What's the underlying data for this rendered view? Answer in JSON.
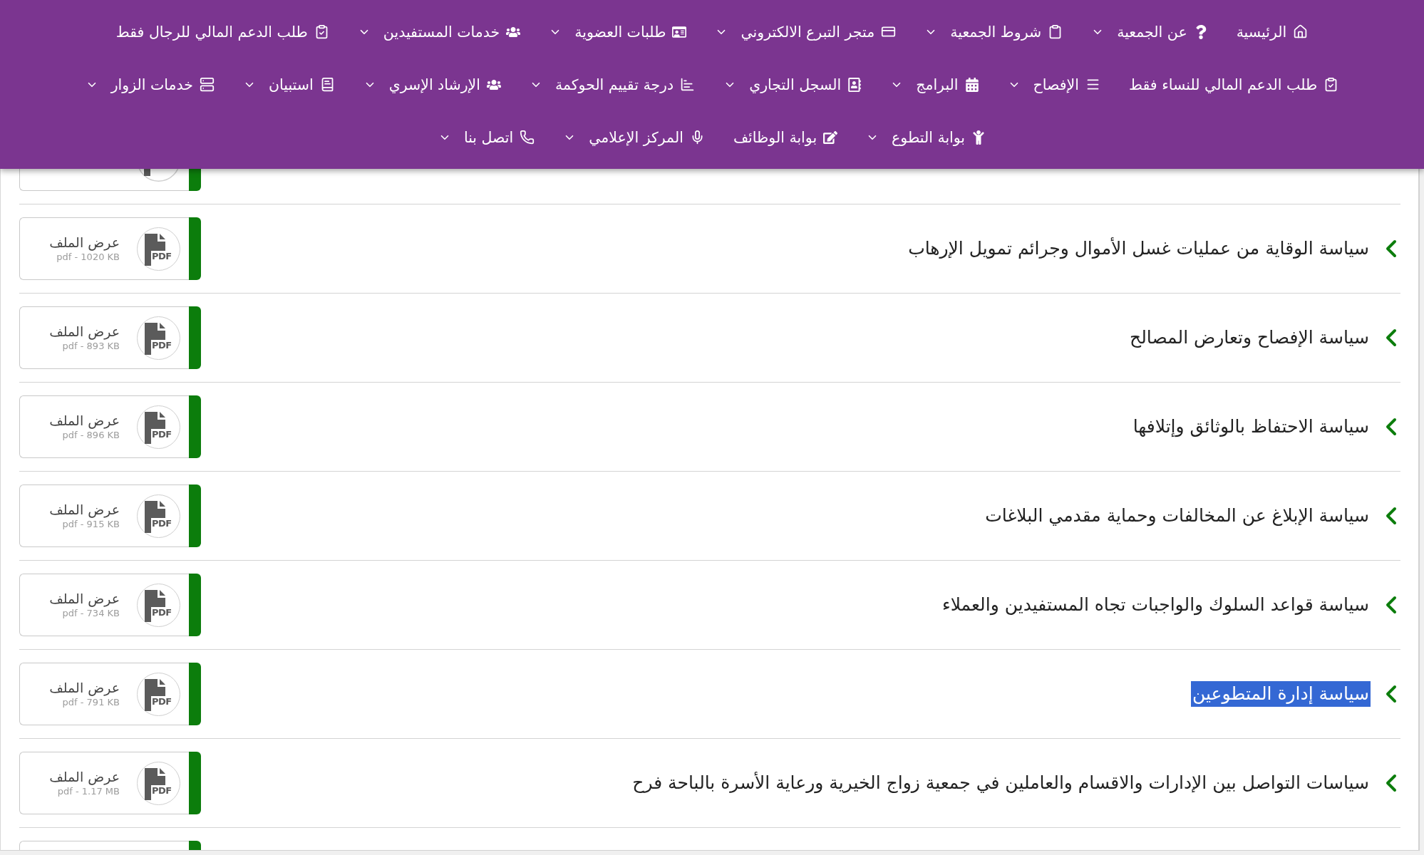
{
  "nav": {
    "rows": [
      {
        "items": [
          {
            "label": "الرئيسية",
            "dropdown": false
          },
          {
            "label": "عن الجمعية",
            "dropdown": true
          },
          {
            "label": "شروط الجمعية",
            "dropdown": true
          },
          {
            "label": "متجر التبرع الالكتروني",
            "dropdown": true
          },
          {
            "label": "طلبات العضوية",
            "dropdown": true
          },
          {
            "label": "خدمات المستفيدين",
            "dropdown": true
          },
          {
            "label": "طلب الدعم المالي للرجال فقط",
            "dropdown": false
          }
        ]
      },
      {
        "items": [
          {
            "label": "طلب الدعم المالي للنساء فقط",
            "dropdown": false
          },
          {
            "label": "الإفصاح",
            "dropdown": true
          },
          {
            "label": "البرامج",
            "dropdown": true
          },
          {
            "label": "السجل التجاري",
            "dropdown": true
          },
          {
            "label": "درجة تقييم الحوكمة",
            "dropdown": true
          },
          {
            "label": "الإرشاد الإسري",
            "dropdown": true
          },
          {
            "label": "استبيان",
            "dropdown": true
          },
          {
            "label": "خدمات الزوار",
            "dropdown": true
          }
        ]
      },
      {
        "items": [
          {
            "label": "بوابة التطوع",
            "dropdown": true
          },
          {
            "label": "بوابة الوظائف",
            "dropdown": false
          },
          {
            "label": "المركز الإعلامي",
            "dropdown": true
          },
          {
            "label": "اتصل بنا",
            "dropdown": true
          }
        ]
      }
    ]
  },
  "documents": [
    {
      "kind": "cut_top"
    },
    {
      "kind": "full",
      "title": "سياسة الوقاية من عمليات غسل الأموال وجرائم تمويل الإرهاب",
      "highlighted": false,
      "action": "عرض الملف",
      "file_type": "PDF",
      "file_info": "pdf - 1020 KB"
    },
    {
      "kind": "full",
      "title": "سياسة الإفصاح وتعارض المصالح",
      "highlighted": false,
      "action": "عرض الملف",
      "file_type": "PDF",
      "file_info": "pdf - 893 KB"
    },
    {
      "kind": "full",
      "title": "سياسة الاحتفاظ بالوثائق وإتلافها",
      "highlighted": false,
      "action": "عرض الملف",
      "file_type": "PDF",
      "file_info": "pdf - 896 KB"
    },
    {
      "kind": "full",
      "title": "سياسة الإبلاغ عن المخالفات وحماية مقدمي البلاغات",
      "highlighted": false,
      "action": "عرض الملف",
      "file_type": "PDF",
      "file_info": "pdf - 915 KB"
    },
    {
      "kind": "full",
      "title": "سياسة قواعد السلوك والواجبات تجاه المستفيدين والعملاء",
      "highlighted": false,
      "action": "عرض الملف",
      "file_type": "PDF",
      "file_info": "pdf - 734 KB"
    },
    {
      "kind": "full",
      "title": "سياسة إدارة المتطوعين",
      "highlighted": true,
      "action": "عرض الملف",
      "file_type": "PDF",
      "file_info": "pdf - 791 KB"
    },
    {
      "kind": "full",
      "title": "سياسات التواصل بين الإدارات والاقسام والعاملين في جمعية زواج الخيرية ورعاية الأسرة بالباحة فرح",
      "highlighted": false,
      "action": "عرض الملف",
      "file_type": "PDF",
      "file_info": "pdf - 1.17 MB"
    },
    {
      "kind": "cut_bottom"
    }
  ]
}
